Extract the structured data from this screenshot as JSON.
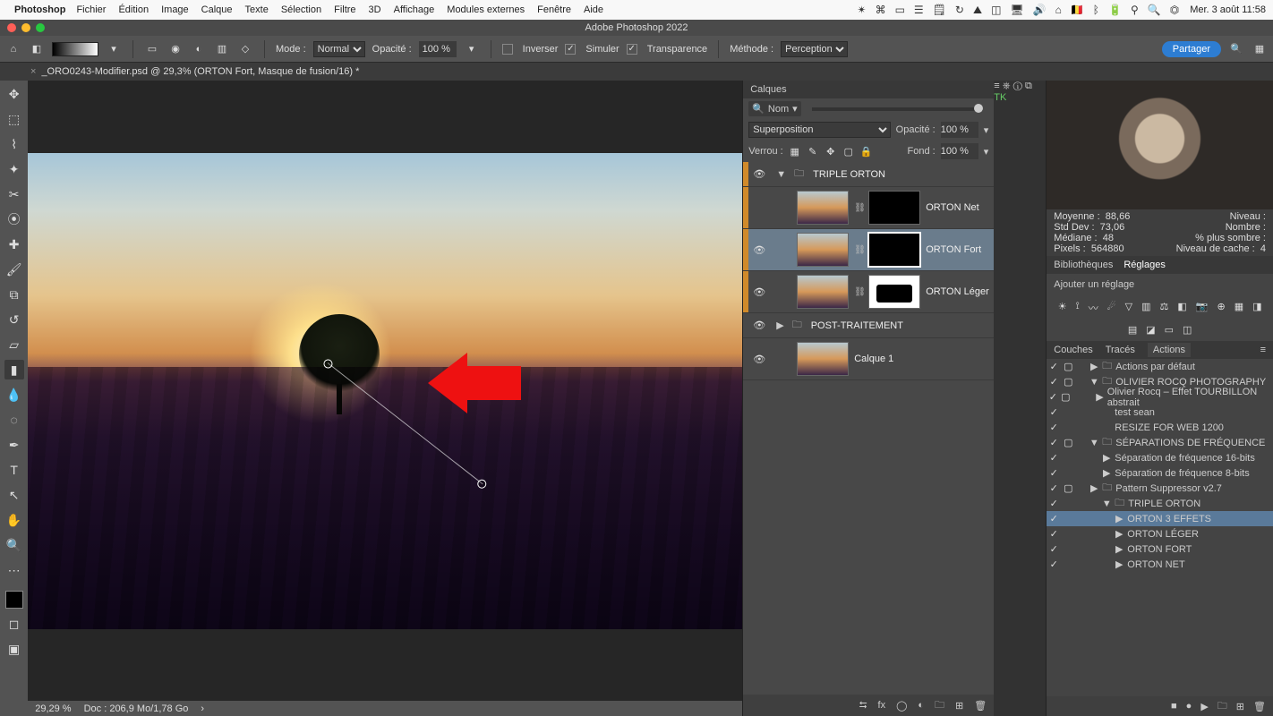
{
  "menubar": {
    "app": "Photoshop",
    "items": [
      "Fichier",
      "Édition",
      "Image",
      "Calque",
      "Texte",
      "Sélection",
      "Filtre",
      "3D",
      "Affichage",
      "Modules externes",
      "Fenêtre",
      "Aide"
    ],
    "flag": "🇧🇪",
    "clock": "Mer. 3 août  11:58"
  },
  "titlebar": {
    "title": "Adobe Photoshop 2022"
  },
  "optbar": {
    "mode_label": "Mode :",
    "mode_value": "Normal",
    "opacity_label": "Opacité :",
    "opacity_value": "100 %",
    "inverser": "Inverser",
    "simuler": "Simuler",
    "transparence": "Transparence",
    "methode_label": "Méthode :",
    "methode_value": "Perception",
    "share": "Partager"
  },
  "tab": {
    "title": "_ORO0243-Modifier.psd @ 29,3% (ORTON Fort, Masque de fusion/16) *"
  },
  "status": {
    "zoom": "29,29 %",
    "docinfo": "Doc : 206,9 Mo/1,78 Go"
  },
  "layers_panel": {
    "tab": "Calques",
    "filter_label": "Nom",
    "blend_value": "Superposition",
    "opacity_label": "Opacité :",
    "opacity_value": "100 %",
    "lock_label": "Verrou :",
    "fill_label": "Fond :",
    "fill_value": "100 %",
    "items": [
      {
        "type": "group",
        "name": "TRIPLE ORTON",
        "orange": true,
        "eye": true,
        "open": true
      },
      {
        "type": "layer",
        "name": "ORTON Net",
        "orange": true,
        "eye": false,
        "mask": "black"
      },
      {
        "type": "layer",
        "name": "ORTON Fort",
        "orange": true,
        "eye": true,
        "mask": "black",
        "selected": true,
        "maskSelected": true
      },
      {
        "type": "layer",
        "name": "ORTON Léger",
        "orange": true,
        "eye": true,
        "mask": "white"
      },
      {
        "type": "group",
        "name": "POST-TRAITEMENT",
        "eye": true,
        "open": false
      },
      {
        "type": "layer",
        "name": "Calque 1",
        "eye": true,
        "plainthumb": true
      }
    ]
  },
  "histogram": {
    "moyenne_l": "Moyenne :",
    "moyenne_v": "88,66",
    "stddev_l": "Std Dev :",
    "stddev_v": "73,06",
    "mediane_l": "Médiane :",
    "mediane_v": "48",
    "pixels_l": "Pixels :",
    "pixels_v": "564880",
    "niveau_l": "Niveau :",
    "nombre_l": "Nombre :",
    "sombre_l": "% plus sombre :",
    "cache_l": "Niveau de cache :",
    "cache_v": "4"
  },
  "adjust": {
    "tab_bib": "Bibliothèques",
    "tab_reg": "Réglages",
    "add": "Ajouter un réglage"
  },
  "actions": {
    "tab_c": "Couches",
    "tab_t": "Tracés",
    "tab_a": "Actions",
    "items": [
      {
        "ind": 0,
        "tw": ">",
        "fld": true,
        "name": "Actions par défaut",
        "box": true
      },
      {
        "ind": 0,
        "tw": "v",
        "fld": true,
        "name": "OLIVIER ROCQ PHOTOGRAPHY",
        "box": true
      },
      {
        "ind": 1,
        "tw": ">",
        "name": "Olivier Rocq – Effet TOURBILLON abstrait",
        "box": true
      },
      {
        "ind": 1,
        "tw": "",
        "name": "test sean"
      },
      {
        "ind": 1,
        "tw": "",
        "name": "RESIZE FOR WEB 1200"
      },
      {
        "ind": 0,
        "tw": "v",
        "fld": true,
        "name": "SÉPARATIONS DE FRÉQUENCE",
        "box": true
      },
      {
        "ind": 1,
        "tw": ">",
        "name": "Séparation de fréquence 16-bits"
      },
      {
        "ind": 1,
        "tw": ">",
        "name": "Séparation de fréquence 8-bits"
      },
      {
        "ind": 0,
        "tw": ">",
        "fld": true,
        "name": "Pattern Suppressor v2.7",
        "box": true
      },
      {
        "ind": 1,
        "tw": "v",
        "fld": true,
        "name": "TRIPLE ORTON"
      },
      {
        "ind": 2,
        "tw": ">",
        "name": "ORTON 3 EFFETS",
        "sel": true
      },
      {
        "ind": 2,
        "tw": ">",
        "name": "ORTON LÉGER"
      },
      {
        "ind": 2,
        "tw": ">",
        "name": "ORTON FORT"
      },
      {
        "ind": 2,
        "tw": ">",
        "name": "ORTON NET"
      }
    ]
  }
}
